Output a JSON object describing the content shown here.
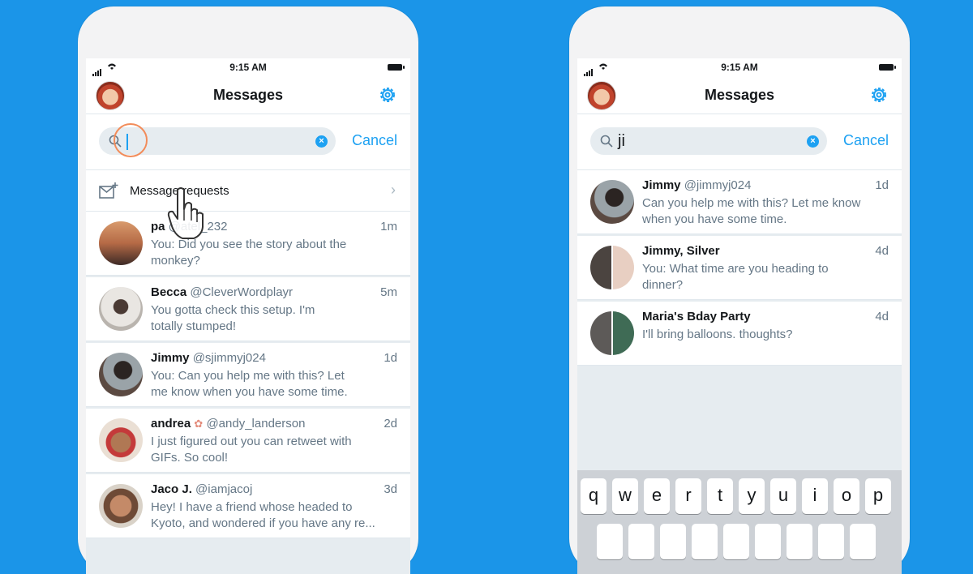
{
  "left": {
    "status": {
      "time": "9:15 AM"
    },
    "nav": {
      "title": "Messages"
    },
    "search": {
      "value": "",
      "cancel": "Cancel"
    },
    "requests": {
      "label": "Message requests"
    },
    "rows": [
      {
        "name": "pa",
        "handle": "@atel_232",
        "time": "1m",
        "msg": "You: Did you see the story about the\nmonkey?"
      },
      {
        "name": "Becca",
        "handle": "@CleverWordplayr",
        "time": "5m",
        "msg": "You gotta check this setup. I'm\ntotally stumped!"
      },
      {
        "name": "Jimmy",
        "handle": "@sjimmyj024",
        "time": "1d",
        "msg": "You: Can you help me with this? Let\nme know when you have some time."
      },
      {
        "name": "andrea",
        "handle": "@andy_landerson",
        "time": "2d",
        "msg": "I just figured out you can retweet with\nGIFs. So cool!"
      },
      {
        "name": "Jaco J.",
        "handle": "@iamjacoj",
        "time": "3d",
        "msg": "Hey! I have a friend whose headed to\nKyoto, and wondered if you have any re..."
      }
    ]
  },
  "right": {
    "status": {
      "time": "9:15 AM"
    },
    "nav": {
      "title": "Messages"
    },
    "search": {
      "value": "ji",
      "cancel": "Cancel"
    },
    "rows": [
      {
        "name": "Jimmy",
        "handle": "@jimmyj024",
        "time": "1d",
        "msg": "Can you help me with this? Let me know\nwhen you have some time."
      },
      {
        "name": "Jimmy, Silver",
        "handle": "",
        "time": "4d",
        "msg": "You: What time are you heading to\ndinner?"
      },
      {
        "name": "Maria's Bday Party",
        "handle": "",
        "time": "4d",
        "msg": "I'll bring balloons. thoughts?"
      }
    ],
    "keyboard": {
      "row1": [
        "q",
        "w",
        "e",
        "r",
        "t",
        "y",
        "u",
        "i",
        "o",
        "p"
      ]
    }
  },
  "colors": {
    "background": "#1b95e8",
    "accent": "#1da1f2",
    "text": "#14171a",
    "muted": "#657786"
  },
  "icons": [
    "signal-icon",
    "wifi-icon",
    "battery-icon",
    "gear-icon",
    "search-icon",
    "clear-icon",
    "mail-plus-icon",
    "chevron-right-icon",
    "hand-cursor-icon"
  ]
}
